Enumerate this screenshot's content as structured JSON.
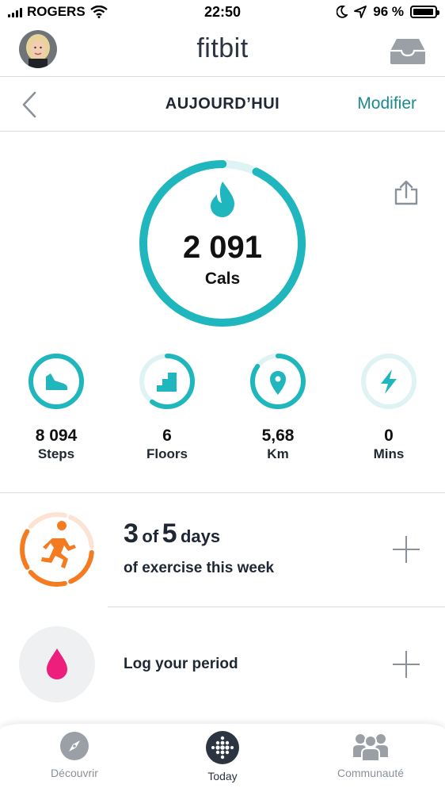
{
  "status_bar": {
    "carrier": "ROGERS",
    "time": "22:50",
    "battery": "96 %",
    "battery_level": 0.96,
    "icons": [
      "signal-icon",
      "wifi-icon",
      "moon-icon",
      "location-arrow-icon",
      "battery-icon"
    ]
  },
  "header": {
    "logo": "fitbit",
    "avatar_icon": "avatar",
    "inbox_icon": "inbox-icon"
  },
  "subheader": {
    "title": "AUJOURD’HUI",
    "modify_label": "Modifier",
    "back_icon": "chevron-left-icon"
  },
  "calories": {
    "value": "2 091",
    "unit": "Cals",
    "progress": 0.93,
    "icon": "flame-icon",
    "share_icon": "share-icon"
  },
  "stats": [
    {
      "value": "8 094",
      "label": "Steps",
      "icon": "shoe-icon",
      "progress": 1.0
    },
    {
      "value": "6",
      "label": "Floors",
      "icon": "stairs-icon",
      "progress": 0.6
    },
    {
      "value": "5,68",
      "label": "Km",
      "icon": "location-pin-icon",
      "progress": 0.85
    },
    {
      "value": "0",
      "label": "Mins",
      "icon": "lightning-icon",
      "progress": 0
    }
  ],
  "exercise": {
    "done": "3",
    "of": "of",
    "goal": "5",
    "unit": "days",
    "subtitle": "of exercise this week",
    "icon": "running-person-icon",
    "days_completed": 3,
    "days_goal": 5
  },
  "period": {
    "label": "Log your period",
    "icon": "droplet-icon"
  },
  "bottom_nav": [
    {
      "label": "Découvrir",
      "icon": "compass-icon",
      "active": false
    },
    {
      "label": "Today",
      "icon": "fitbit-dots-icon",
      "active": true
    },
    {
      "label": "Communauté",
      "icon": "community-icon",
      "active": false
    }
  ],
  "colors": {
    "teal": "#1fb6bd",
    "teal_light": "#dff3f4",
    "accent_text": "#1a8a8f",
    "orange": "#f47b20",
    "orange_light": "#fde3d3",
    "pink": "#ee1f7c"
  }
}
